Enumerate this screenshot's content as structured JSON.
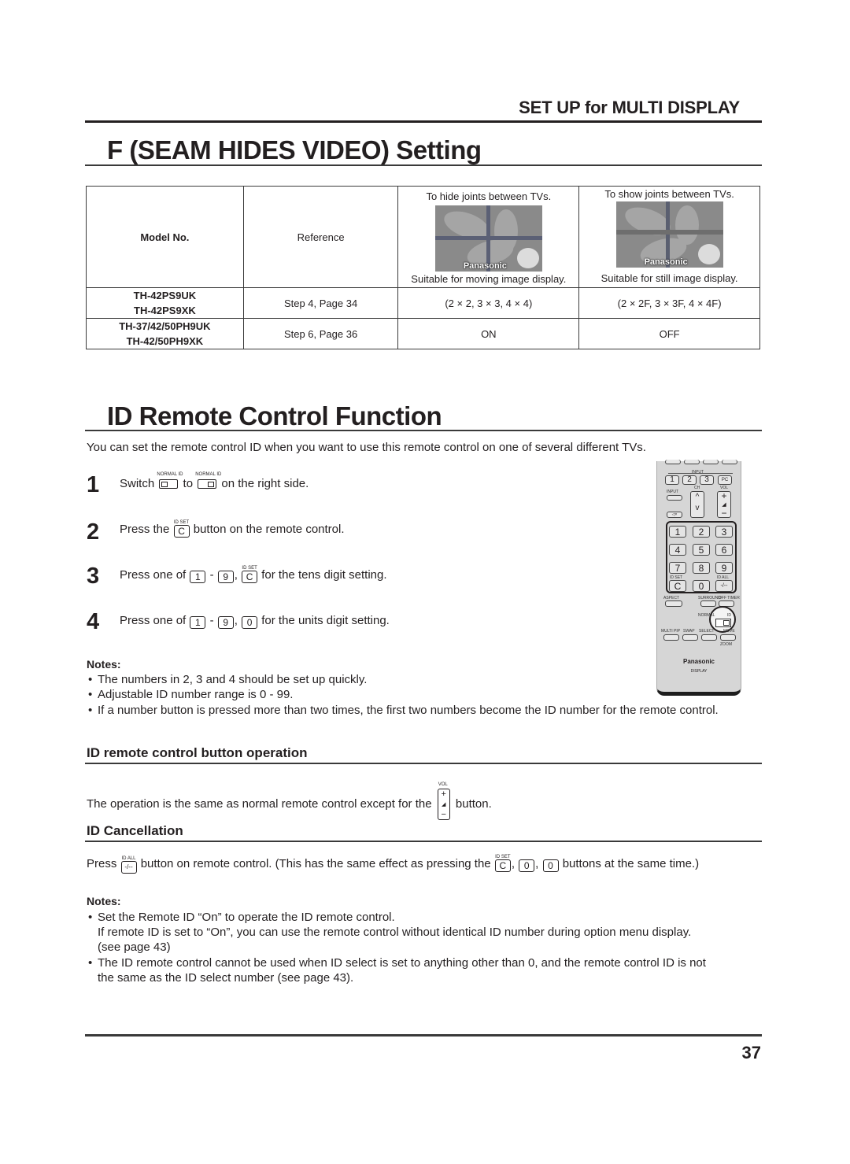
{
  "header": {
    "section": "SET UP for MULTI DISPLAY"
  },
  "seam": {
    "title": "F (SEAM HIDES VIDEO) Setting",
    "table": {
      "headers": {
        "model": "Model No.",
        "reference": "Reference",
        "on_caption_top": "To hide joints between TVs.",
        "on_caption_bottom": "Suitable for moving image display.",
        "off_caption_top": "To show joints between TVs.",
        "off_caption_bottom": "Suitable for still image display.",
        "image_brand": "Panasonic"
      },
      "rows": [
        {
          "models": [
            "TH-42PS9UK",
            "TH-42PS9XK"
          ],
          "reference": "Step 4, Page 34",
          "on_value": "(2 × 2, 3 × 3, 4 × 4)",
          "off_value": "(2 × 2F, 3 × 3F, 4 × 4F)"
        },
        {
          "models": [
            "TH-37/42/50PH9UK",
            "TH-42/50PH9XK"
          ],
          "reference": "Step 6, Page 36",
          "on_value": "ON",
          "off_value": "OFF"
        }
      ]
    }
  },
  "id_remote": {
    "title": "ID Remote Control Function",
    "intro": "You can set the remote control ID when you want to use this remote control on one of several different TVs.",
    "steps": [
      {
        "num": "1",
        "pre": "Switch",
        "mid": "to",
        "post": "on the right side.",
        "switch_left": "NORMAL",
        "switch_right": "ID"
      },
      {
        "num": "2",
        "pre": "Press the",
        "key": "C",
        "key_label": "ID SET",
        "post": "button on the remote control."
      },
      {
        "num": "3",
        "pre": "Press one of",
        "key_a": "1",
        "dash": "-",
        "key_b": "9",
        "key_c": "C",
        "key_c_label": "ID SET",
        "post": "for the tens digit setting."
      },
      {
        "num": "4",
        "pre": "Press one of",
        "key_a": "1",
        "dash": "-",
        "key_b": "9",
        "key_c": "0",
        "post": "for the units digit setting."
      }
    ],
    "notes_title": "Notes:",
    "notes": [
      "The numbers in 2, 3 and 4 should be set up quickly.",
      "Adjustable ID number range is 0 - 99.",
      "If a number button is pressed more than two times, the first two numbers become the ID number for the remote control."
    ],
    "remote": {
      "input_group_label": "INPUT",
      "input_keys": [
        "1",
        "2",
        "3",
        "PC"
      ],
      "input_btn_label": "INPUT",
      "ch_label": "CH",
      "ch_up": "^",
      "ch_down": "v",
      "vol_label": "VOL",
      "vol_plus": "+",
      "vol_minus": "−",
      "mute_icon": "◁×",
      "numpad": [
        "1",
        "2",
        "3",
        "4",
        "5",
        "6",
        "7",
        "8",
        "9",
        "C",
        "0",
        "-/--"
      ],
      "id_set_label": "ID SET",
      "id_all_label": "ID ALL",
      "aspect_label": "ASPECT",
      "surround_label": "SURROUND",
      "off_timer_label": "OFF TIMER",
      "switch_normal": "NORMAL",
      "switch_id": "ID",
      "bottom_labels": [
        "MULTI PIP",
        "SWAP",
        "SELECT",
        "MOVE"
      ],
      "zoom_label": "ZOOM",
      "brand": "Panasonic",
      "sub": "DISPLAY"
    }
  },
  "button_op": {
    "title": "ID remote control button operation",
    "pre": "The operation is the same as normal remote control except for the",
    "key_label": "VOL",
    "post": "button."
  },
  "cancellation": {
    "title": "ID Cancellation",
    "pre": "Press",
    "key_all": "-/--",
    "key_all_label": "ID ALL",
    "mid": "button on remote control. (This has the same effect as pressing the",
    "key_c": "C",
    "key_c_label": "ID SET",
    "key_0a": "0",
    "key_0b": "0",
    "comma": ",",
    "post": "buttons at the same time.)",
    "notes_title": "Notes:",
    "notes": [
      {
        "text": "Set the Remote ID “On” to operate the ID remote control.",
        "cont": [
          "If remote ID is set to “On”, you can use the remote control without identical ID number during option menu display.",
          "(see page 43)"
        ]
      },
      {
        "text": "The ID remote control cannot be used when ID select is set to anything other than 0, and the remote control ID is not",
        "cont": [
          "the same as the ID select number (see page 43)."
        ]
      }
    ]
  },
  "footer": {
    "page_number": "37"
  }
}
